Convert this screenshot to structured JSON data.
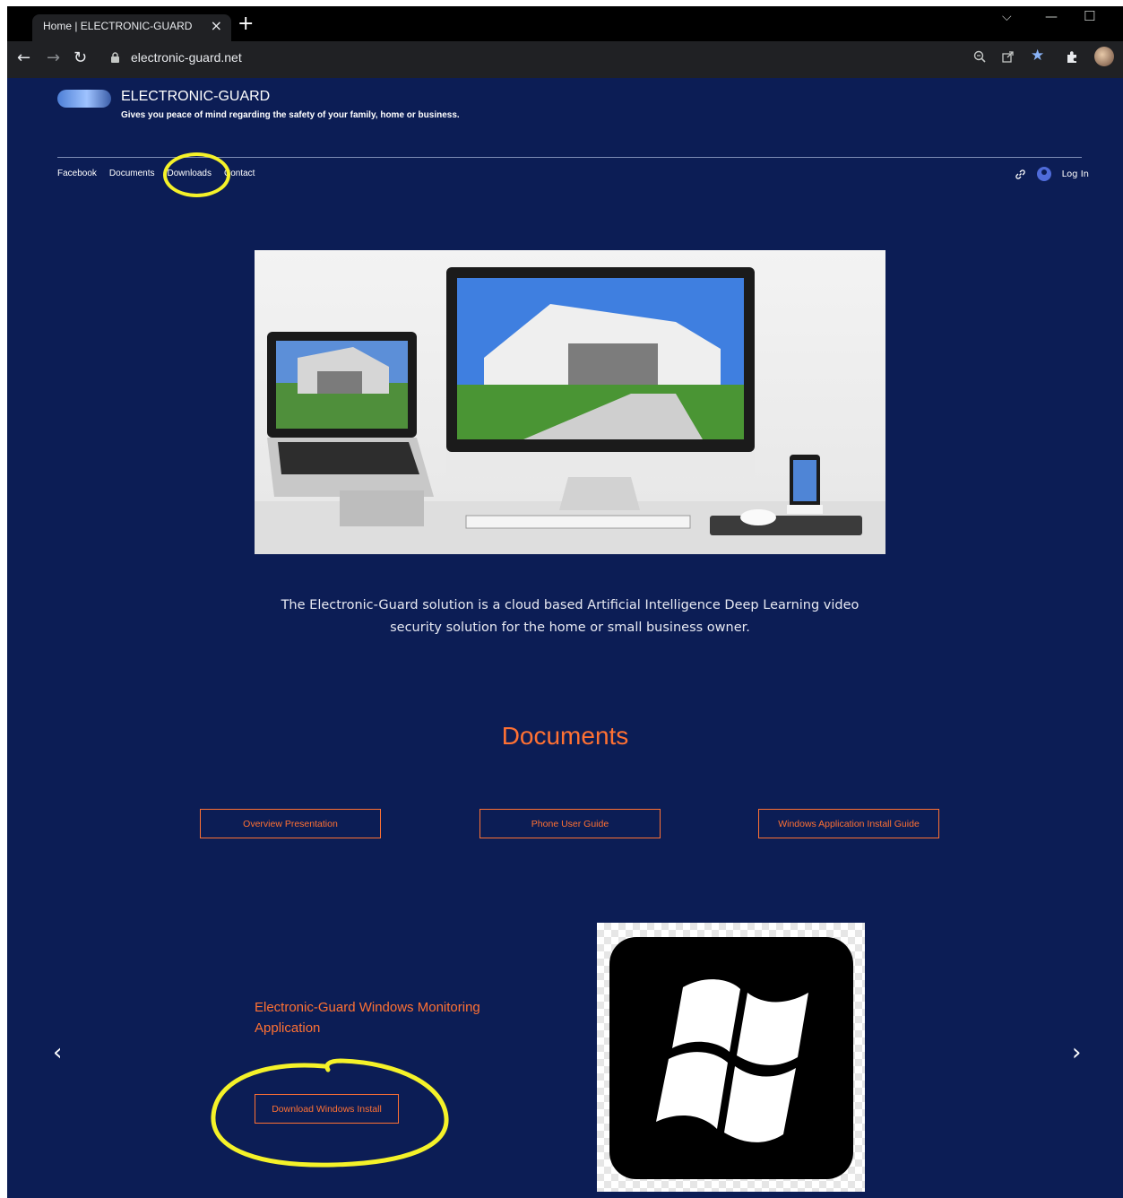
{
  "browser": {
    "tab_title": "Home | ELECTRONIC-GUARD",
    "tab_close": "×",
    "new_tab": "+",
    "url": "electronic-guard.net",
    "icons": [
      "back-arrow-icon",
      "forward-arrow-icon",
      "reload-icon",
      "lock-icon",
      "zoom-icon",
      "share-icon",
      "star-icon",
      "extensions-icon",
      "profile-avatar-icon"
    ]
  },
  "site": {
    "title": "ELECTRONIC-GUARD",
    "tagline": "Gives you peace of mind regarding the safety of your family, home or business.",
    "menu": [
      "Facebook",
      "Documents",
      "Downloads",
      "Contact"
    ],
    "login_label": "Log In",
    "description": "The Electronic-Guard solution is a cloud based Artificial Intelligence Deep Learning video security solution for the home or small business owner.",
    "documents": {
      "heading": "Documents",
      "buttons": [
        "Overview Presentation",
        "Phone User Guide",
        "Windows Application Install Guide"
      ]
    },
    "slide": {
      "title": "Electronic-Guard Windows Monitoring Application",
      "button": "Download Windows Install",
      "prev_arrow": "‹",
      "next_arrow": "›"
    }
  },
  "colors": {
    "page_bg": "#0c1d55",
    "accent": "#ff7133",
    "annotation": "#f5f229"
  }
}
